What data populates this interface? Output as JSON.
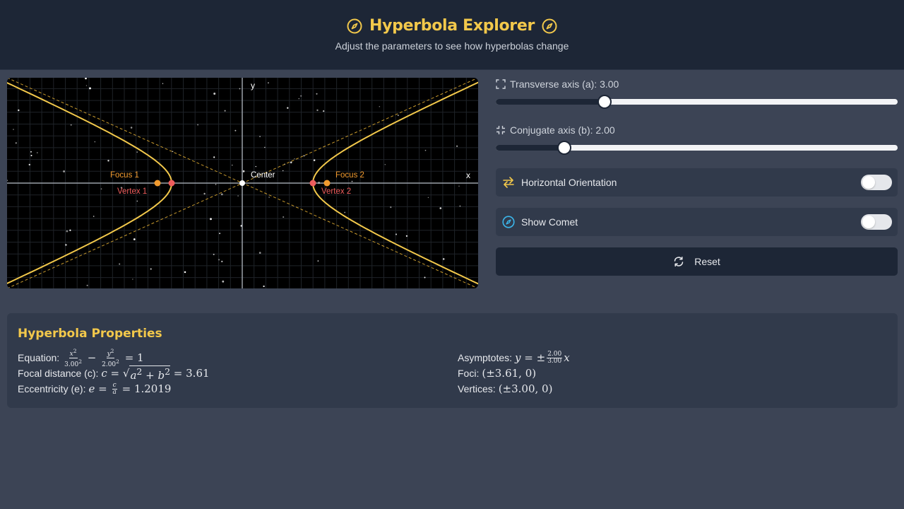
{
  "header": {
    "title": "Hyperbola Explorer",
    "subtitle": "Adjust the parameters to see how hyperbolas change",
    "title_icon": "compass-icon"
  },
  "plot": {
    "axis_x_label": "x",
    "axis_y_label": "y",
    "center_label": "Center",
    "focus1_label": "Focus 1",
    "focus2_label": "Focus 2",
    "vertex1_label": "Vertex 1",
    "vertex2_label": "Vertex 2",
    "colors": {
      "curve": "#f2c84b",
      "asymptote": "#c89a2e",
      "vertex": "#ef5d5d",
      "focus": "#f29b2f",
      "center": "#ffffff"
    }
  },
  "controls": {
    "a": {
      "label": "Transverse axis (a): 3.00",
      "value": 3.0,
      "fraction": 0.27,
      "icon": "expand-icon"
    },
    "b": {
      "label": "Conjugate axis (b): 2.00",
      "value": 2.0,
      "fraction": 0.17,
      "icon": "shrink-icon"
    },
    "orientation": {
      "label": "Horizontal Orientation",
      "on": false,
      "icon": "swap-arrows-icon"
    },
    "comet": {
      "label": "Show Comet",
      "on": false,
      "icon": "compass-icon"
    },
    "reset": {
      "label": "Reset",
      "icon": "refresh-icon"
    }
  },
  "properties": {
    "title": "Hyperbola Properties",
    "equation_label": "Equation:",
    "equation_a_sq": "3.00",
    "equation_b_sq": "2.00",
    "focal_label": "Focal distance (c):",
    "focal_value": "3.61",
    "eccentricity_label": "Eccentricity (e):",
    "eccentricity_value": "1.2019",
    "asymptotes_label": "Asymptotes:",
    "asym_num": "2.00",
    "asym_den": "3.00",
    "foci_label": "Foci:",
    "foci_value": "(±3.61, 0)",
    "vertices_label": "Vertices:",
    "vertices_value": "(±3.00, 0)"
  }
}
